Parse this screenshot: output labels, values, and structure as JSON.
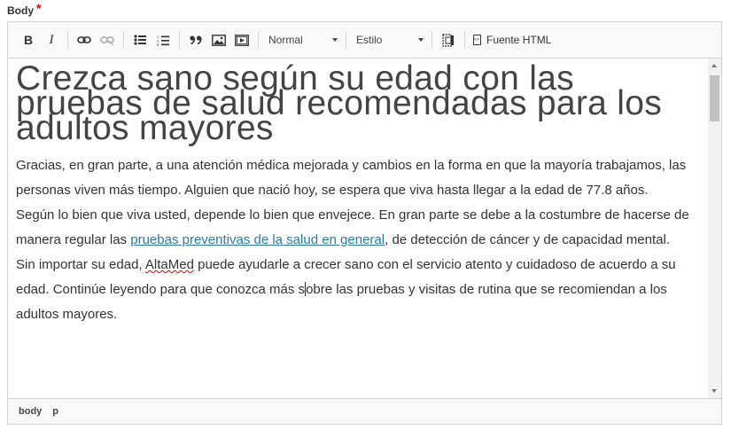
{
  "field": {
    "label": "Body",
    "required_mark": "*"
  },
  "toolbar": {
    "format_combo": "Normal",
    "style_combo": "Estilo",
    "source_label": "Fuente HTML"
  },
  "document": {
    "heading": "Crezca sano según su edad con las pruebas de salud recomendadas para los adultos mayores",
    "p1": "Gracias, en gran parte, a una atención médica mejorada y cambios en la forma en que la mayoría trabajamos, las personas viven más tiempo. Alguien que nació hoy, se espera que viva hasta llegar a la edad de 77.8 años.",
    "p2_before_link": "Según lo bien que viva usted, depende lo bien que envejece. En gran parte se debe a la costumbre de hacerse de manera regular las ",
    "p2_link": "pruebas preventivas de la salud en general",
    "p2_mid": ", de detección de cáncer y de capacidad mental. Sin importar su edad, ",
    "p2_brand": "AltaMed",
    "p2_before_caret": " puede ayudarle a crecer sano con el servicio atento y cuidadoso de acuerdo a su edad. Continúe leyendo para que conozca más s",
    "p2_after_caret": "obre las pruebas y visitas de rutina que se recomiendan a los adultos mayores."
  },
  "pathbar": {
    "items": [
      "body",
      "p"
    ]
  }
}
